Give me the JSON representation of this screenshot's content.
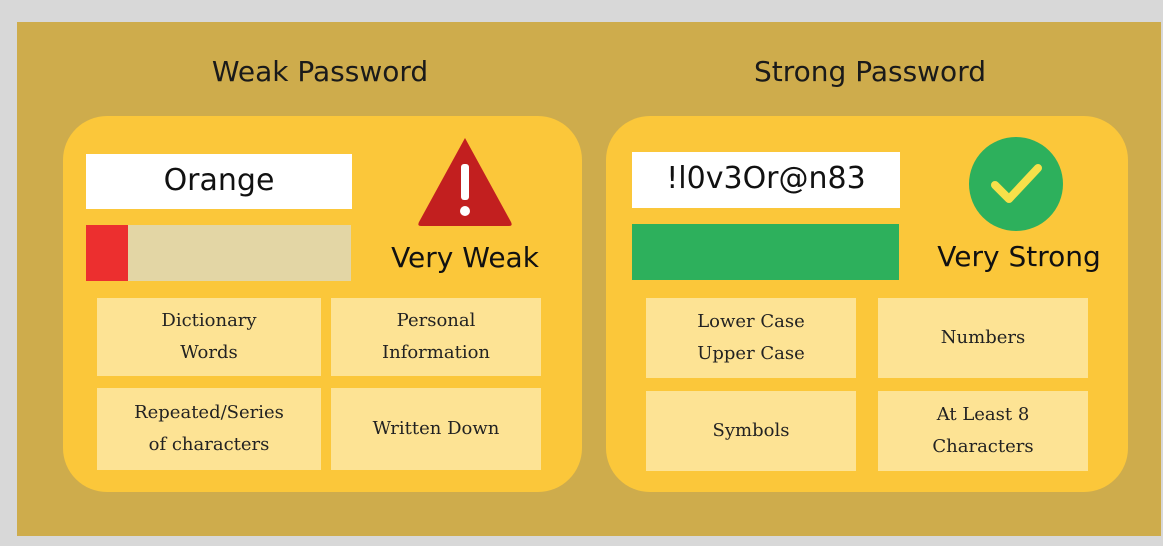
{
  "weak": {
    "title": "Weak Password",
    "password": "Orange",
    "rating": "Very Weak",
    "strength_fraction": 0.16,
    "meter_color": "#ec2f2f",
    "meter_track_color": "#e3d6a5",
    "icon": "warning-triangle-icon",
    "icon_color": "#c21f1f",
    "traits": [
      {
        "line1": "Dictionary",
        "line2": "Words"
      },
      {
        "line1": "Personal",
        "line2": "Information"
      },
      {
        "line1": "Repeated/Series",
        "line2": "of characters"
      },
      {
        "line1": "Written Down",
        "line2": ""
      }
    ]
  },
  "strong": {
    "title": "Strong Password",
    "password": "!l0v3Or@n83",
    "rating": "Very Strong",
    "strength_fraction": 1.0,
    "meter_color": "#2db05c",
    "icon": "check-circle-icon",
    "icon_color": "#2db05c",
    "traits": [
      {
        "line1": "Lower Case",
        "line2": "Upper Case"
      },
      {
        "line1": "Numbers",
        "line2": ""
      },
      {
        "line1": "Symbols",
        "line2": ""
      },
      {
        "line1": "At Least 8",
        "line2": "Characters"
      }
    ]
  },
  "colors": {
    "background": "#ceac4c",
    "panel": "#fbc73a",
    "card": "#fde394"
  }
}
